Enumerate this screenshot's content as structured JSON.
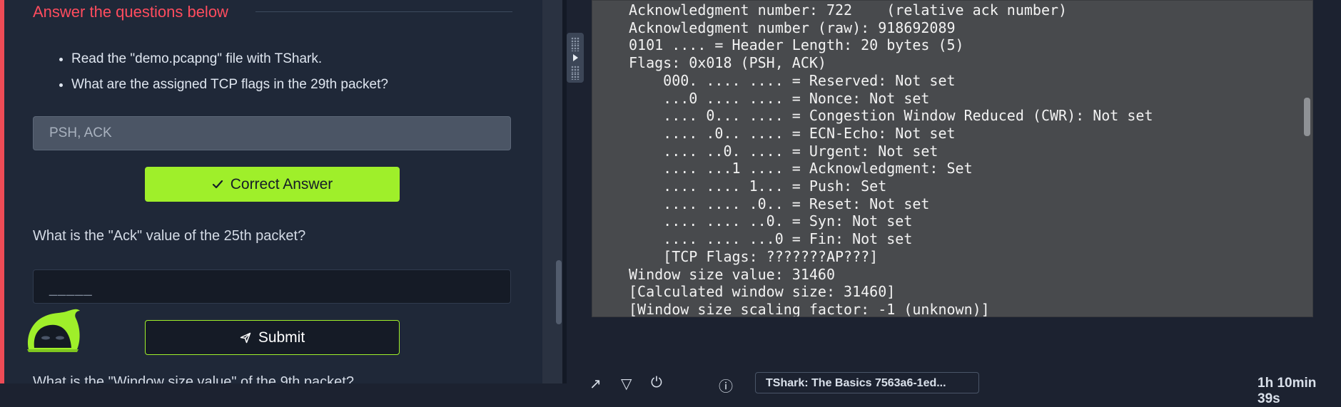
{
  "task": {
    "section_title": "Answer the questions below",
    "questions": [
      "Read the \"demo.pcapng\" file with TShark.",
      "What are the assigned TCP flags in the 29th packet?"
    ],
    "answer_1": "PSH, ACK",
    "correct_label": "Correct Answer",
    "question_2": "What is the \"Ack\" value of the 25th packet?",
    "answer_2_placeholder": "_____",
    "submit_label": "Submit",
    "next_question_partial": "What is the \"Window size value\" of the 9th packet?"
  },
  "terminal": {
    "lines": [
      "Acknowledgment number: 722    (relative ack number)",
      "Acknowledgment number (raw): 918692089",
      "0101 .... = Header Length: 20 bytes (5)",
      "Flags: 0x018 (PSH, ACK)",
      "    000. .... .... = Reserved: Not set",
      "    ...0 .... .... = Nonce: Not set",
      "    .... 0... .... = Congestion Window Reduced (CWR): Not set",
      "    .... .0.. .... = ECN-Echo: Not set",
      "    .... ..0. .... = Urgent: Not set",
      "    .... ...1 .... = Acknowledgment: Set",
      "    .... .... 1... = Push: Set",
      "    .... .... .0.. = Reset: Not set",
      "    .... .... ..0. = Syn: Not set",
      "    .... .... ...0 = Fin: Not set",
      "    [TCP Flags: ???????AP???]",
      "Window size value: 31460",
      "[Calculated window size: 31460]",
      "[Window size scaling factor: -1 (unknown)]"
    ]
  },
  "toolbar": {
    "vm_label": "TShark: The Basics 7563a6-1ed...",
    "timer": "1h 10min 39s"
  },
  "colors": {
    "accent_red": "#ee4b56",
    "accent_green": "#9fef2a",
    "terminal_bg": "#484a4d"
  },
  "icons": [
    "check-icon",
    "send-icon",
    "mascot-icon",
    "expand-icon",
    "power-icon",
    "info-icon",
    "drag-handle-icon",
    "play-arrow-icon"
  ]
}
